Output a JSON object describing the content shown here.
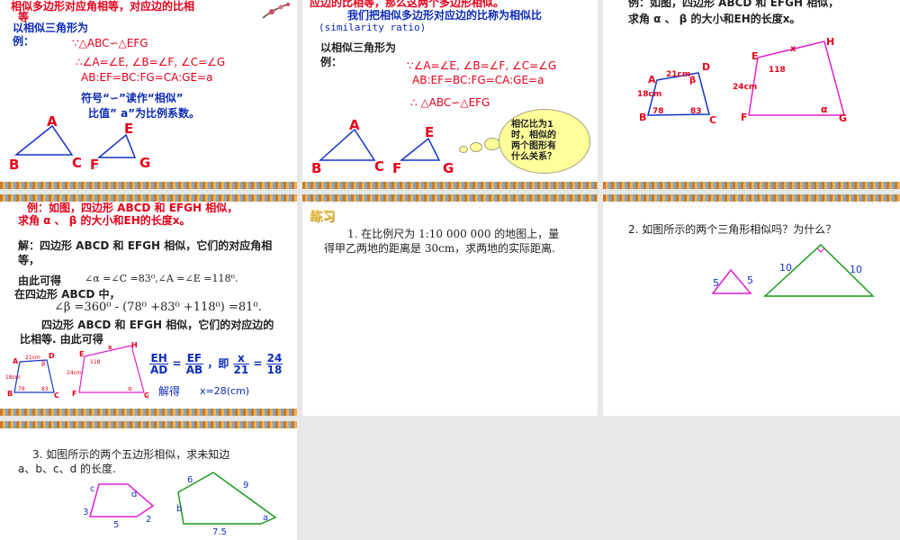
{
  "slide1": {
    "line1": "相似多边形对应角相等，对应边的比相",
    "line1b": "等",
    "example_intro": "以相似三角形为",
    "example_label": "例：",
    "given": "∵△ABC∽△EFG",
    "conclusion_angles": "∴∠A=∠E, ∠B=∠F, ∠C=∠G",
    "conclusion_sides": "AB:EF=BC:FG=CA:GE=a",
    "symbol_line1": "符号“∽”读作“相似”",
    "symbol_line2": "比值” a”为比例系数。",
    "tri1": {
      "A": "A",
      "B": "B",
      "C": "C"
    },
    "tri2": {
      "E": "E",
      "F": "F",
      "G": "G"
    }
  },
  "slide2": {
    "top_line": "应边的比相等，那么这两个多边形相似。",
    "ratio_line": "我们把相似多边形对应边的比称为相似比",
    "ratio_en": "(similarity ratio)",
    "example_intro": "以相似三角形为",
    "example_label": "例：",
    "angles": "∵∠A=∠E, ∠B=∠F, ∠C=∠G",
    "sides": "AB:EF=BC:FG=CA:GE=a",
    "conclusion": "∴ △ABC∽△EFG",
    "cloud_lines": [
      "相亿比为1",
      "时，相似的",
      "两个图形有",
      "什么关系？"
    ],
    "tri1": {
      "A": "A",
      "B": "B",
      "C": "C"
    },
    "tri2": {
      "E": "E",
      "F": "F",
      "G": "G"
    }
  },
  "slide3": {
    "line1": "例：如图，四边形 ABCD 和 EFGH 相似，",
    "line2": "求角 α 、 β 的大小和EH的长度x。",
    "labels": {
      "A": "A",
      "B": "B",
      "C": "C",
      "D": "D",
      "E": "E",
      "F": "F",
      "G": "G",
      "H": "H",
      "x": "x",
      "beta": "β",
      "alpha": "α",
      "s21": "21cm",
      "s18": "18cm",
      "s24": "24cm",
      "a78": "78",
      "a83": "83",
      "a118": "118"
    }
  },
  "slide4": {
    "line1": "例：如图，四边形 ABCD 和 EFGH 相似，",
    "line2": "求角 α 、 β 的大小和EH的长度x。",
    "sol1": "解：四边形 ABCD 和 EFGH 相似，它们的对应角相",
    "sol1b": "等，",
    "sol2_lead": "由此可得",
    "sol2_math": "∠α =∠C =83⁰,∠A =∠E =118⁰.",
    "sol3": "在四边形 ABCD 中，",
    "sol3_math": "∠β =360⁰ - (78⁰ +83⁰ +118⁰) =81⁰.",
    "sol4": "四边形 ABCD 和 EFGH 相似，它们的对应边的",
    "sol4b": "比相等. 由此可得",
    "eq_left_num": "EH",
    "eq_left_den": "AD",
    "eq_mid_num": "EF",
    "eq_mid_den": "AB",
    "eq_sep": "，即",
    "eq_x_num": "x",
    "eq_x_den": "21",
    "eq_r_num": "24",
    "eq_r_den": "18",
    "answer_label": "解得",
    "answer": "x=28(cm)",
    "labels": {
      "A": "A",
      "B": "B",
      "C": "C",
      "D": "D",
      "E": "E",
      "F": "F",
      "G": "G",
      "H": "H",
      "x": "x",
      "s21": "21cm",
      "s18": "18cm",
      "s24": "24cm",
      "a78": "78",
      "a83": "83",
      "a118": "118",
      "beta": "β",
      "alpha": "α"
    }
  },
  "slide5": {
    "title": "练习",
    "q1_line1": "1. 在比例尺为 1:10 000 000 的地图上，量",
    "q1_line2": "得甲乙两地的距离是 30cm，求两地的实际距离."
  },
  "slide6": {
    "q2": "2. 如图所示的两个三角形相似吗？为什么？",
    "small": {
      "left": "5",
      "right": "5"
    },
    "big": {
      "left": "10",
      "right": "10"
    }
  },
  "slide7": {
    "q3_line1": "3. 如图所示的两个五边形相似，求未知边",
    "q3_line2": "a、b、c、d 的长度.",
    "small": {
      "c": "c",
      "d": "d",
      "s3": "3",
      "s5": "5",
      "s2": "2"
    },
    "big": {
      "s6": "6",
      "s9": "9",
      "b": "b",
      "a": "a",
      "s75": "7.5"
    }
  }
}
